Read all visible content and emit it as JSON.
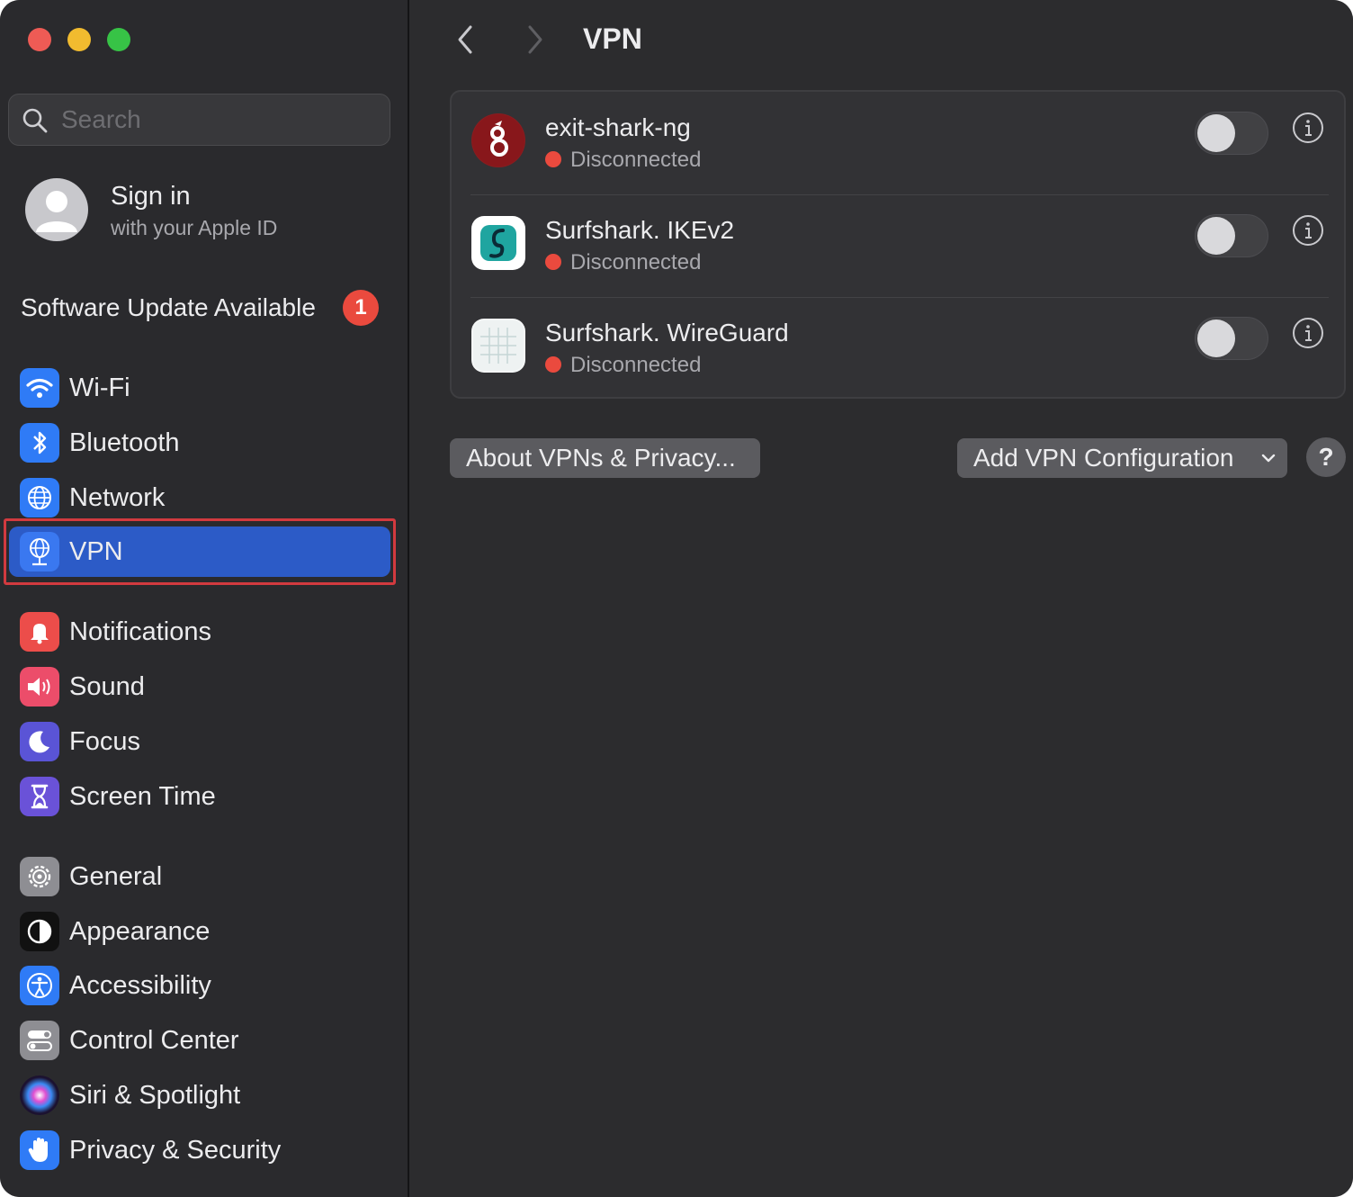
{
  "window": {
    "title": "VPN"
  },
  "sidebar": {
    "search": {
      "placeholder": "Search",
      "value": ""
    },
    "account": {
      "title": "Sign in",
      "subtitle": "with your Apple ID"
    },
    "update": {
      "label": "Software Update Available",
      "badge": "1"
    },
    "items": [
      {
        "id": "wifi",
        "label": "Wi-Fi",
        "icon": "wifi-icon",
        "color": "#2f7bf6"
      },
      {
        "id": "bluetooth",
        "label": "Bluetooth",
        "icon": "bluetooth-icon",
        "color": "#2f7bf6"
      },
      {
        "id": "network",
        "label": "Network",
        "icon": "globe-icon",
        "color": "#2f7bf6"
      },
      {
        "id": "vpn",
        "label": "VPN",
        "icon": "vpn-globe-icon",
        "color": "#2f7bf6",
        "selected": true
      },
      {
        "id": "notifications",
        "label": "Notifications",
        "icon": "bell-icon",
        "color": "#ec4d4a"
      },
      {
        "id": "sound",
        "label": "Sound",
        "icon": "speaker-icon",
        "color": "#ec4d6a"
      },
      {
        "id": "focus",
        "label": "Focus",
        "icon": "moon-icon",
        "color": "#5a54d6"
      },
      {
        "id": "screen-time",
        "label": "Screen Time",
        "icon": "hourglass-icon",
        "color": "#6a52d8"
      },
      {
        "id": "general",
        "label": "General",
        "icon": "gear-icon",
        "color": "#8e8e93"
      },
      {
        "id": "appearance",
        "label": "Appearance",
        "icon": "appearance-icon",
        "color": "#111111"
      },
      {
        "id": "accessibility",
        "label": "Accessibility",
        "icon": "accessibility-icon",
        "color": "#2f7bf6"
      },
      {
        "id": "control-center",
        "label": "Control Center",
        "icon": "switches-icon",
        "color": "#8e8e93"
      },
      {
        "id": "siri",
        "label": "Siri & Spotlight",
        "icon": "siri-icon",
        "color": "#3a2a6a"
      },
      {
        "id": "privacy",
        "label": "Privacy & Security",
        "icon": "hand-icon",
        "color": "#2f7bf6"
      }
    ]
  },
  "main": {
    "title": "VPN",
    "vpns": [
      {
        "name": "exit-shark-ng",
        "status": "Disconnected",
        "enabled": false,
        "logo": "wireguard-dragon-logo"
      },
      {
        "name": "Surfshark. IKEv2",
        "status": "Disconnected",
        "enabled": false,
        "logo": "surfshark-logo"
      },
      {
        "name": "Surfshark. WireGuard",
        "status": "Disconnected",
        "enabled": false,
        "logo": "wireguard-grid-logo"
      }
    ],
    "about_button": "About VPNs & Privacy...",
    "add_button": "Add VPN Configuration",
    "help_button": "?"
  },
  "colors": {
    "selected": "#2c5bc7",
    "status_disconnected": "#ea4a3e",
    "badge": "#ea4a3e",
    "selection_outline": "#d23a3f"
  }
}
